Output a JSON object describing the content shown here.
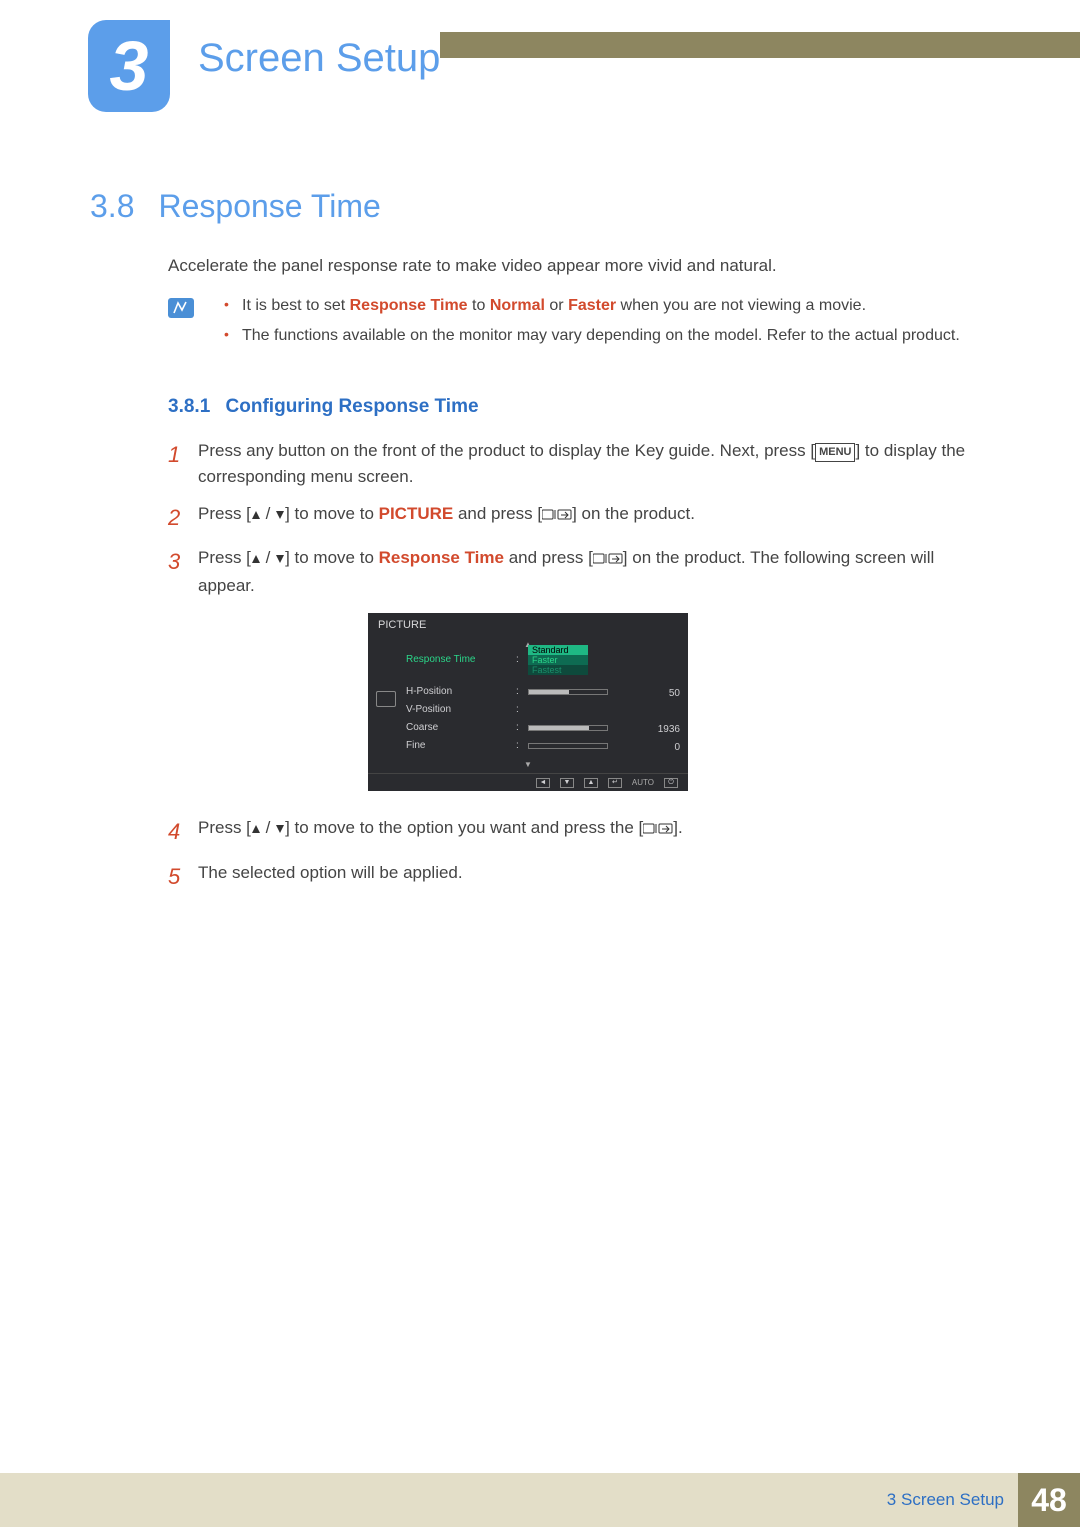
{
  "chapter": {
    "number": "3",
    "title": "Screen Setup"
  },
  "section": {
    "number": "3.8",
    "title": "Response Time"
  },
  "intro": "Accelerate the panel response rate to make video appear more vivid and natural.",
  "notes": {
    "item1": {
      "pre": "It is best to set ",
      "hl1": "Response Time",
      "mid1": " to ",
      "hl2": "Normal",
      "mid2": " or ",
      "hl3": "Faster",
      "post": " when you are not viewing a movie."
    },
    "item2": "The functions available on the monitor may vary depending on the model. Refer to the actual product."
  },
  "subsection": {
    "number": "3.8.1",
    "title": "Configuring Response Time"
  },
  "steps": {
    "s1": {
      "pre": "Press any button on the front of the product to display the Key guide. Next, press [",
      "menu": "MENU",
      "post": "] to display the corresponding menu screen."
    },
    "s2": {
      "pre": "Press [",
      "mid1": "] to move to ",
      "hl": "PICTURE",
      "mid2": " and press [",
      "post": "] on the product."
    },
    "s3": {
      "pre": "Press [",
      "mid1": "] to move to ",
      "hl": "Response Time",
      "mid2": " and press [",
      "post": "] on the product. The following screen will appear."
    },
    "s4": {
      "pre": "Press [",
      "mid": "] to move to the option you want and press the [",
      "post": "]."
    },
    "s5": "The selected option will be applied."
  },
  "osd": {
    "title": "PICTURE",
    "items": {
      "response_time": "Response Time",
      "h_position": "H-Position",
      "v_position": "V-Position",
      "coarse": "Coarse",
      "fine": "Fine"
    },
    "options": {
      "standard": "Standard",
      "faster": "Faster",
      "fastest": "Fastest"
    },
    "values": {
      "h_position": "50",
      "coarse": "1936",
      "fine": "0"
    },
    "auto": "AUTO"
  },
  "footer": {
    "label": "3 Screen Setup",
    "page": "48"
  }
}
